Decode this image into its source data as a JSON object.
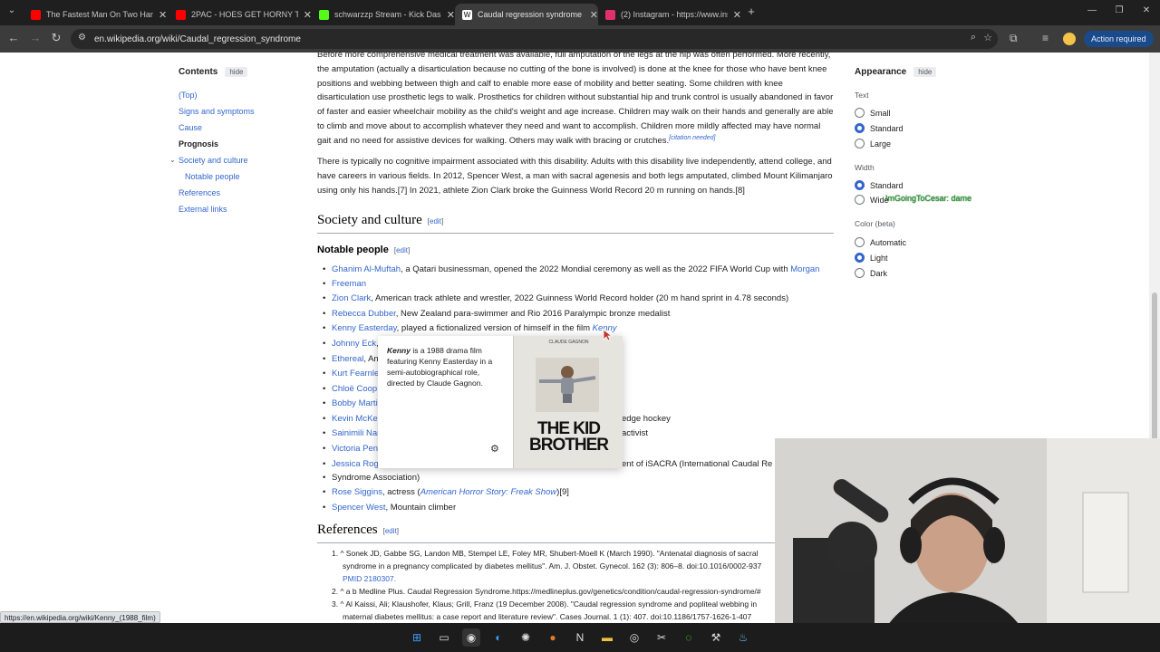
{
  "browser": {
    "tabs": [
      {
        "title": "The Fastest Man On Two Hand",
        "color": "#ff0000"
      },
      {
        "title": "2PAC - HOES GET HORNY THE",
        "color": "#ff0000"
      },
      {
        "title": "schwarzzp Stream - Kick Dashb",
        "color": "#53fc18"
      },
      {
        "title": "Caudal regression syndrome - W",
        "color": "#ffffff"
      },
      {
        "title": "(2) Instagram - https://www.ins",
        "color": "#e1306c"
      }
    ],
    "new_tab": "+",
    "url": "en.wikipedia.org/wiki/Caudal_regression_syndrome",
    "action_required": "Action required"
  },
  "toc": {
    "heading": "Contents",
    "hide": "hide",
    "items": [
      "(Top)",
      "Signs and symptoms",
      "Cause",
      "Prognosis",
      "Society and culture",
      "Notable people",
      "References",
      "External links"
    ]
  },
  "article": {
    "p1": "Before more comprehensive medical treatment was available, full amputation of the legs at the hip was often performed. More recently, the amputation (actually a disarticulation because no cutting of the bone is involved) is done at the knee for those who have bent knee positions and webbing between thigh and calf to enable more ease of mobility and better seating. Some children with knee disarticulation use prosthetic legs to walk. Prosthetics for children without substantial hip and trunk control is usually abandoned in favor of faster and easier wheelchair mobility as the child's weight and age increase. Children may walk on their hands and generally are able to climb and move about to accomplish whatever they need and want to accomplish. Children more mildly affected may have normal gait and no need for assistive devices for walking. Others may walk with bracing or crutches.",
    "citation_needed": "[citation needed]",
    "p2": "There is typically no cognitive impairment associated with this disability. Adults with this disability live independently, attend college, and have careers in various fields. In 2012, Spencer West, a man with sacral agenesis and both legs amputated, climbed Mount Kilimanjaro using only his hands.[7] In 2021, athlete Zion Clark broke the Guinness World Record 20 m running on hands.[8]",
    "society_heading": "Society and culture",
    "edit": "edit",
    "notable_heading": "Notable people",
    "people": [
      {
        "link": "Ghanim Al-Muftah",
        "text": ", a Qatari businessman, opened the 2022 Mondial ceremony as well as the 2022 FIFA World Cup with ",
        "link2": "Morgan"
      },
      {
        "link": "Freeman",
        "text": ""
      },
      {
        "link": "Zion Clark",
        "text": ", American track athlete and wrestler, 2022 Guinness World Record holder (20 m hand sprint in 4.78 seconds)"
      },
      {
        "link": "Rebecca Dubber",
        "text": ", New Zealand para-swimmer and Rio 2016 Paralympic bronze medalist"
      },
      {
        "link": "Kenny Easterday",
        "text": ", played a fictionalized version of himself in the film ",
        "link2": "Kenny"
      },
      {
        "link": "Johnny Eck",
        "text": ","
      },
      {
        "link": "Ethereal",
        "text": ", Am"
      },
      {
        "link": "Kurt Fearnle",
        "text": ""
      },
      {
        "link": "Chloë Coop",
        "text": ""
      },
      {
        "link": "Bobby Marti",
        "text": ""
      },
      {
        "link": "Kevin McKe",
        "text": "",
        "tail": "edge hockey"
      },
      {
        "link": "Sainimili Nar",
        "text": "",
        "tail": "activist"
      },
      {
        "link": "Victoria Pen",
        "text": ""
      },
      {
        "link": "Jessica Rog",
        "text": "",
        "tail": "ent of iSACRA (International Caudal Re"
      },
      {
        "link": "",
        "text": "Syndrome Association)"
      },
      {
        "link": "Rose Siggins",
        "text": ", actress (",
        "link2": "American Horror Story: Freak Show",
        "after": ")[9]"
      },
      {
        "link": "Spencer West",
        "text": ", Mountain climber"
      }
    ],
    "references_heading": "References",
    "refs": [
      "1. ^ Sonek JD, Gabbe SG, Landon MB, Stempel LE, Foley MR, Shubert-Moell K (March 1990). \"Antenatal diagnosis of sacral",
      "syndrome in a pregnancy complicated by diabetes mellitus\". Am. J. Obstet. Gynecol. 162 (3): 806–8. doi:10.1016/0002-937",
      "PMID 2180307.",
      "2. ^ a b Medline Plus. Caudal Regression Syndrome.https://medlineplus.gov/genetics/condition/caudal-regression-syndrome/#",
      "3. ^ Al Kaissi, Ali; Klaushofer, Klaus; Grill, Franz (19 December 2008). \"Caudal regression syndrome and popliteal webbing in",
      "maternal diabetes mellitus: a case report and literature review\". Cases Journal. 1 (1): 407. doi:10.1186/1757-1626-1-407"
    ]
  },
  "popup": {
    "title_bold": "Kenny",
    "text": " is a 1988 drama film featuring Kenny Easterday in a semi-autobiographical role, directed by Claude Gagnon.",
    "poster_title_1": "THE KID",
    "poster_title_2": "BROTHER",
    "poster_caption": "CLAUDE GAGNON"
  },
  "appearance": {
    "heading": "Appearance",
    "hide": "hide",
    "text_label": "Text",
    "text_options": [
      "Small",
      "Standard",
      "Large"
    ],
    "width_label": "Width",
    "width_options": [
      "Standard",
      "Wide"
    ],
    "color_label": "Color (beta)",
    "color_options": [
      "Automatic",
      "Light",
      "Dark"
    ],
    "overlay_text": "ImGoingToCesar: dame"
  },
  "status_url": "https://en.wikipedia.org/wiki/Kenny_(1988_film)"
}
